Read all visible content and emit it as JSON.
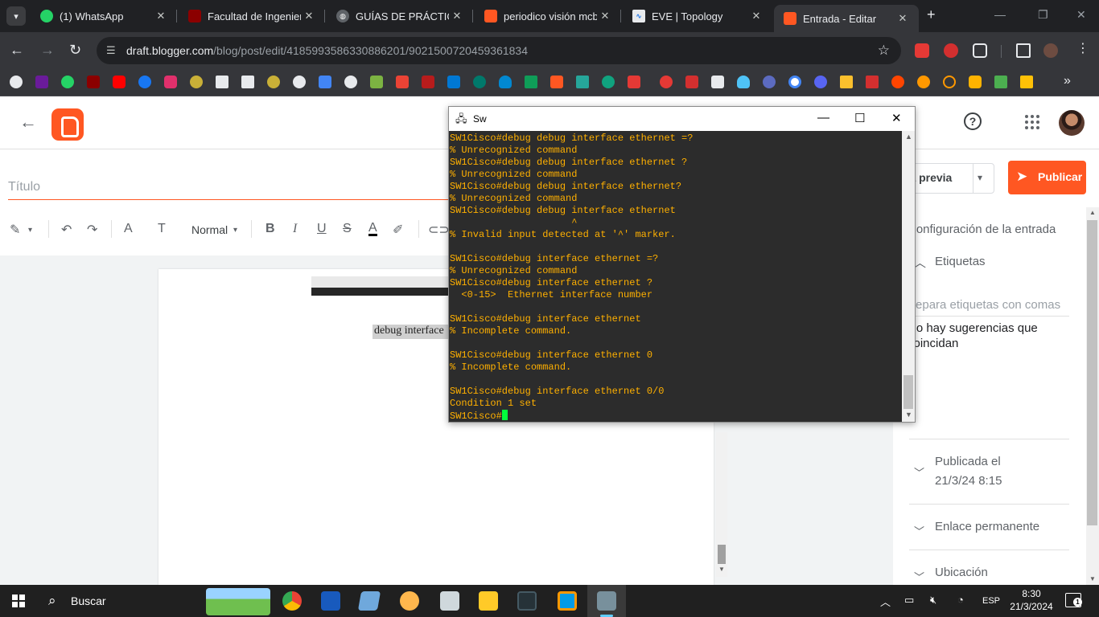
{
  "browser": {
    "tabs": [
      {
        "title": "(1) WhatsApp",
        "icon": "whatsapp-icon",
        "color": "#25d366"
      },
      {
        "title": "Facultad de Ingeniería",
        "icon": "faculty-icon",
        "color": "#8b0000"
      },
      {
        "title": "GUÍAS DE PRÁCTICAS",
        "icon": "globe-icon",
        "color": "#9aa0a6"
      },
      {
        "title": "periodico visión mcbr",
        "icon": "blogger-icon",
        "color": "#ff5722"
      },
      {
        "title": "EVE | Topology",
        "icon": "eve-icon",
        "color": "#e8eaed"
      },
      {
        "title": "Entrada - Editar",
        "icon": "blogger-icon",
        "color": "#ff5722"
      }
    ],
    "url_host": "draft.blogger.com",
    "url_path": "/blog/post/edit/4185993586330886201/9021500720459361834"
  },
  "editor": {
    "title_placeholder": "Título",
    "paragraph_style": "Normal",
    "body_text": "debug interface"
  },
  "sidebar": {
    "preview_label": "Vista previa",
    "publish_label": "Publicar",
    "settings_heading": "Configuración de la entrada",
    "labels_heading": "Etiquetas",
    "labels_placeholder": "Separa etiquetas con comas",
    "labels_empty": "No hay sugerencias que coincidan",
    "published_label": "Publicada el",
    "published_date": "21/3/24 8:15",
    "permalink_label": "Enlace permanente",
    "location_label": "Ubicación"
  },
  "terminal": {
    "title": "Sw",
    "lines": [
      "SW1Cisco#debug debug interface ethernet =?",
      "% Unrecognized command",
      "SW1Cisco#debug debug interface ethernet ?",
      "% Unrecognized command",
      "SW1Cisco#debug debug interface ethernet?",
      "% Unrecognized command",
      "SW1Cisco#debug debug interface ethernet",
      "                     ^",
      "% Invalid input detected at '^' marker.",
      "",
      "SW1Cisco#debug interface ethernet =?",
      "% Unrecognized command",
      "SW1Cisco#debug interface ethernet ?",
      "  <0-15>  Ethernet interface number",
      "",
      "SW1Cisco#debug interface ethernet",
      "% Incomplete command.",
      "",
      "SW1Cisco#debug interface ethernet 0",
      "% Incomplete command.",
      "",
      "SW1Cisco#debug interface ethernet 0/0",
      "Condition 1 set"
    ],
    "prompt": "SW1Cisco#"
  },
  "taskbar": {
    "search_label": "Buscar",
    "language": "ESP",
    "time": "8:30",
    "date": "21/3/2024",
    "notifications": "1"
  },
  "colors": {
    "accent": "#ff5722",
    "terminal_text": "#ffb000",
    "terminal_bg": "#2c2c2c",
    "cursor": "#00ff3c"
  }
}
